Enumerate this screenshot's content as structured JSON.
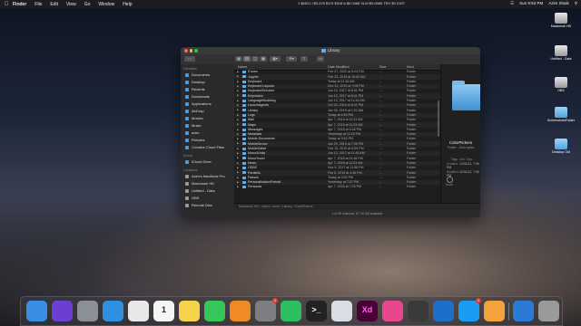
{
  "menubar": {
    "apple": "",
    "items": [
      "Finder",
      "File",
      "Edit",
      "View",
      "Go",
      "Window",
      "Help"
    ],
    "ticker": "1 $6521  ł $0.229  BCH $318  A $0.0466  XLM $0.0566  TRX $0.0157",
    "user": "Azim Shaik",
    "time": "Sun 9:53 PM"
  },
  "desktop": [
    {
      "label": "Macintosh HD",
      "icon": "drive-icon"
    },
    {
      "label": "Untitled - Data",
      "icon": "drive-icon"
    },
    {
      "label": "OBS",
      "icon": "drive-icon"
    },
    {
      "label": "ScreenshotsFolder",
      "icon": "folder-icon"
    },
    {
      "label": "Desktop Old",
      "icon": "folder-icon"
    }
  ],
  "window": {
    "title": "Library",
    "sidebar": {
      "favorites_header": "Favorites",
      "favorites": [
        "Documents",
        "Desktop",
        "Recents",
        "Downloads",
        "Applications",
        "AirDrop",
        "Movies",
        "Music",
        "azim",
        "Pictures",
        "Creative Cloud Files"
      ],
      "icloud_header": "iCloud",
      "icloud": [
        "iCloud Drive"
      ],
      "locations_header": "Locations",
      "locations": [
        "Azim's MacBook Pro",
        "Macintosh HD",
        "Untitled - Data",
        "OBS",
        "Remote Disc"
      ]
    },
    "columns": {
      "name": "Name",
      "date": "Date Modified",
      "size": "Size",
      "kind": "Kind"
    },
    "rows": [
      {
        "name": "iTunes",
        "date": "Feb 27, 2020 at 9:23 PM",
        "size": "--",
        "kind": "Folder"
      },
      {
        "name": "Jupyter",
        "date": "Feb 23, 2019 at 10:52 AM",
        "size": "--",
        "kind": "Folder"
      },
      {
        "name": "Keyboard",
        "date": "Today at 11:16 AM",
        "size": "--",
        "kind": "Folder"
      },
      {
        "name": "Keyboard Layouts",
        "date": "Dec 31, 2019 at 7:05 PM",
        "size": "--",
        "kind": "Folder"
      },
      {
        "name": "KeyboardServices",
        "date": "Jun 12, 2017 at 8:41 PM",
        "size": "--",
        "kind": "Folder"
      },
      {
        "name": "Keychains",
        "date": "Jun 12, 2017 at 8:41 PM",
        "size": "--",
        "kind": "Folder"
      },
      {
        "name": "LanguageModeling",
        "date": "Jun 12, 2017 at 11:46 AM",
        "size": "--",
        "kind": "Folder"
      },
      {
        "name": "LaunchAgents",
        "date": "Oct 26, 2019 at 8:41 PM",
        "size": "--",
        "kind": "Folder"
      },
      {
        "name": "Library",
        "date": "Jan 30, 2019 at 1:02 AM",
        "size": "--",
        "kind": "Folder"
      },
      {
        "name": "Logs",
        "date": "Today at 4:53 PM",
        "size": "--",
        "kind": "Folder"
      },
      {
        "name": "Mail",
        "date": "Apr 7, 2018 at 11:23 AM",
        "size": "--",
        "kind": "Folder"
      },
      {
        "name": "Maps",
        "date": "Apr 7, 2018 at 11:23 AM",
        "size": "--",
        "kind": "Folder"
      },
      {
        "name": "Messages",
        "date": "Apr 7, 2018 at 4:46 PM",
        "size": "--",
        "kind": "Folder"
      },
      {
        "name": "Metadata",
        "date": "Yesterday at 12:15 PM",
        "size": "--",
        "kind": "Folder"
      },
      {
        "name": "Mobile Documents",
        "date": "Today at 9:52 PM",
        "size": "--",
        "kind": "Folder"
      },
      {
        "name": "MobileDevice",
        "date": "Jan 29, 2019 at 7:36 PM",
        "size": "--",
        "kind": "Folder"
      },
      {
        "name": "MobileSafari",
        "date": "Feb 15, 2019 at 5:59 PM",
        "size": "--",
        "kind": "Folder"
      },
      {
        "name": "Mono4Unity",
        "date": "Jun 12, 2017 at 11:45 AM",
        "size": "--",
        "kind": "Folder"
      },
      {
        "name": "MonoTouch",
        "date": "Apr 7, 2018 at 11:48 PM",
        "size": "--",
        "kind": "Folder"
      },
      {
        "name": "News",
        "date": "Apr 7, 2018 at 11:23 AM",
        "size": "--",
        "kind": "Folder"
      },
      {
        "name": "ODBC",
        "date": "Nov 9, 2017 at 11:56 PM",
        "size": "--",
        "kind": "Folder"
      },
      {
        "name": "Parallels",
        "date": "Feb 6, 2019 at 4:36 PM",
        "size": "--",
        "kind": "Folder"
      },
      {
        "name": "Passes",
        "date": "Today at 3:52 PM",
        "size": "--",
        "kind": "Folder"
      },
      {
        "name": "PersonalizationPortrait",
        "date": "Yesterday at 7:27 PM",
        "size": "--",
        "kind": "Folder"
      },
      {
        "name": "Personas",
        "date": "Apr 7, 2018 at 7:25 PM",
        "size": "--",
        "kind": "Folder"
      }
    ],
    "pathbar": "Macintosh HD  ›  Users  ›  azim  ›  Library  ›  ColorPickers",
    "statusbar": "1 of 95 selected, 87.16 GB available",
    "preview": {
      "name": "ColorPickers",
      "subtitle": "Folder - Zero bytes",
      "tags_label": "Tags",
      "tags_value": "Add Tags...",
      "created_label": "Created",
      "created_value": "12/31/12, 7:05 PM",
      "modified_label": "Modified",
      "modified_value": "12/31/12, 7:05 PM",
      "more_label": "More..."
    }
  },
  "dock": [
    {
      "name": "finder",
      "color": "#3b8ee6"
    },
    {
      "name": "siri",
      "color": "#6c3fd1"
    },
    {
      "name": "launchpad",
      "color": "#8a8f98"
    },
    {
      "name": "safari",
      "color": "#2f8fe0"
    },
    {
      "name": "chrome",
      "color": "#e8e8e8"
    },
    {
      "name": "calendar",
      "color": "#f5f5f5",
      "text": "1"
    },
    {
      "name": "notes",
      "color": "#f6d34a"
    },
    {
      "name": "facetime",
      "color": "#35c759"
    },
    {
      "name": "books",
      "color": "#f08a24"
    },
    {
      "name": "system-preferences",
      "color": "#7d7d82",
      "badge": "1"
    },
    {
      "name": "evernote",
      "color": "#2dbe60"
    },
    {
      "name": "terminal",
      "color": "#222222",
      "text": ">_"
    },
    {
      "name": "tableau",
      "color": "#d9dde6"
    },
    {
      "name": "adobe-xd",
      "color": "#470137",
      "text": "Xd"
    },
    {
      "name": "app-store-pink",
      "color": "#e8478f"
    },
    {
      "name": "obs",
      "color": "#3a3a3a"
    },
    {
      "name": "edge",
      "color": "#1e6fc9"
    },
    {
      "name": "app-store",
      "color": "#1a9cf2",
      "badge": "1"
    },
    {
      "name": "infuse",
      "color": "#f2a33a"
    },
    {
      "name": "vscode",
      "color": "#2a7ad6"
    },
    {
      "name": "trash",
      "color": "#9a9a9a"
    }
  ]
}
